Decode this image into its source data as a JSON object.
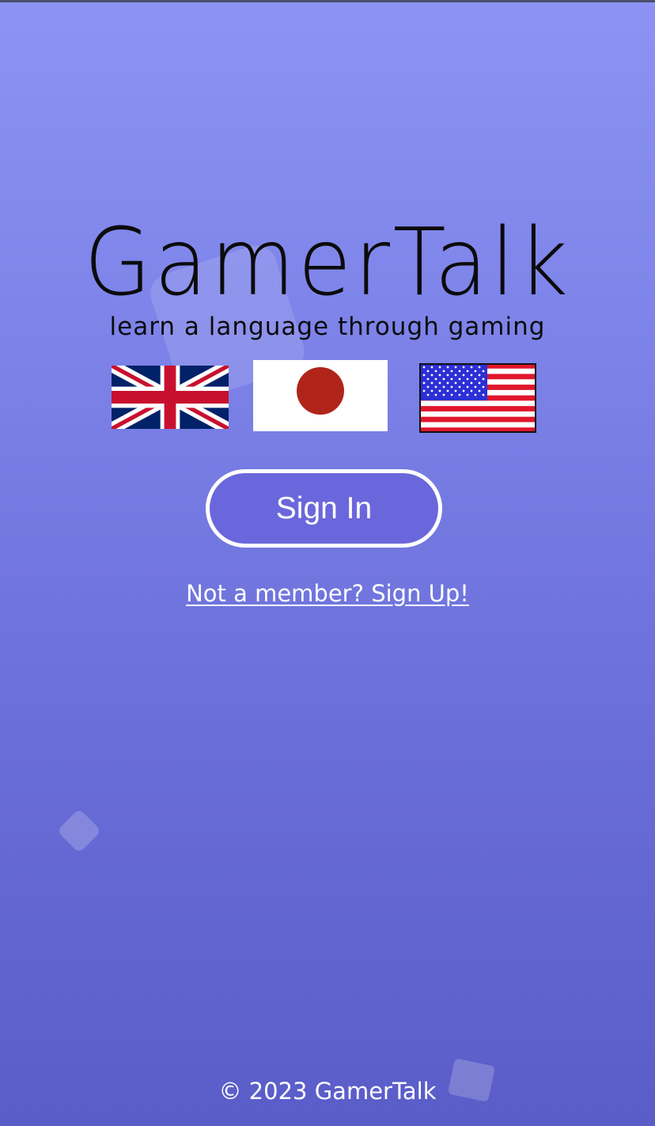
{
  "app": {
    "title": "GamerTalk",
    "tagline": "learn a language through gaming"
  },
  "flags": [
    {
      "name": "uk-flag-icon",
      "language": "English (UK)"
    },
    {
      "name": "japan-flag-icon",
      "language": "Japanese"
    },
    {
      "name": "us-flag-icon",
      "language": "English (US)"
    }
  ],
  "actions": {
    "sign_in_label": "Sign In",
    "sign_up_link": "Not a member? Sign Up!"
  },
  "footer": {
    "copyright": "© 2023 GamerTalk"
  },
  "colors": {
    "background_top": "#8c93f4",
    "background_bottom": "#5a5cc8",
    "button_fill": "#6a67dc",
    "text_light": "#ffffff",
    "logo_text": "#0b0b0b"
  }
}
